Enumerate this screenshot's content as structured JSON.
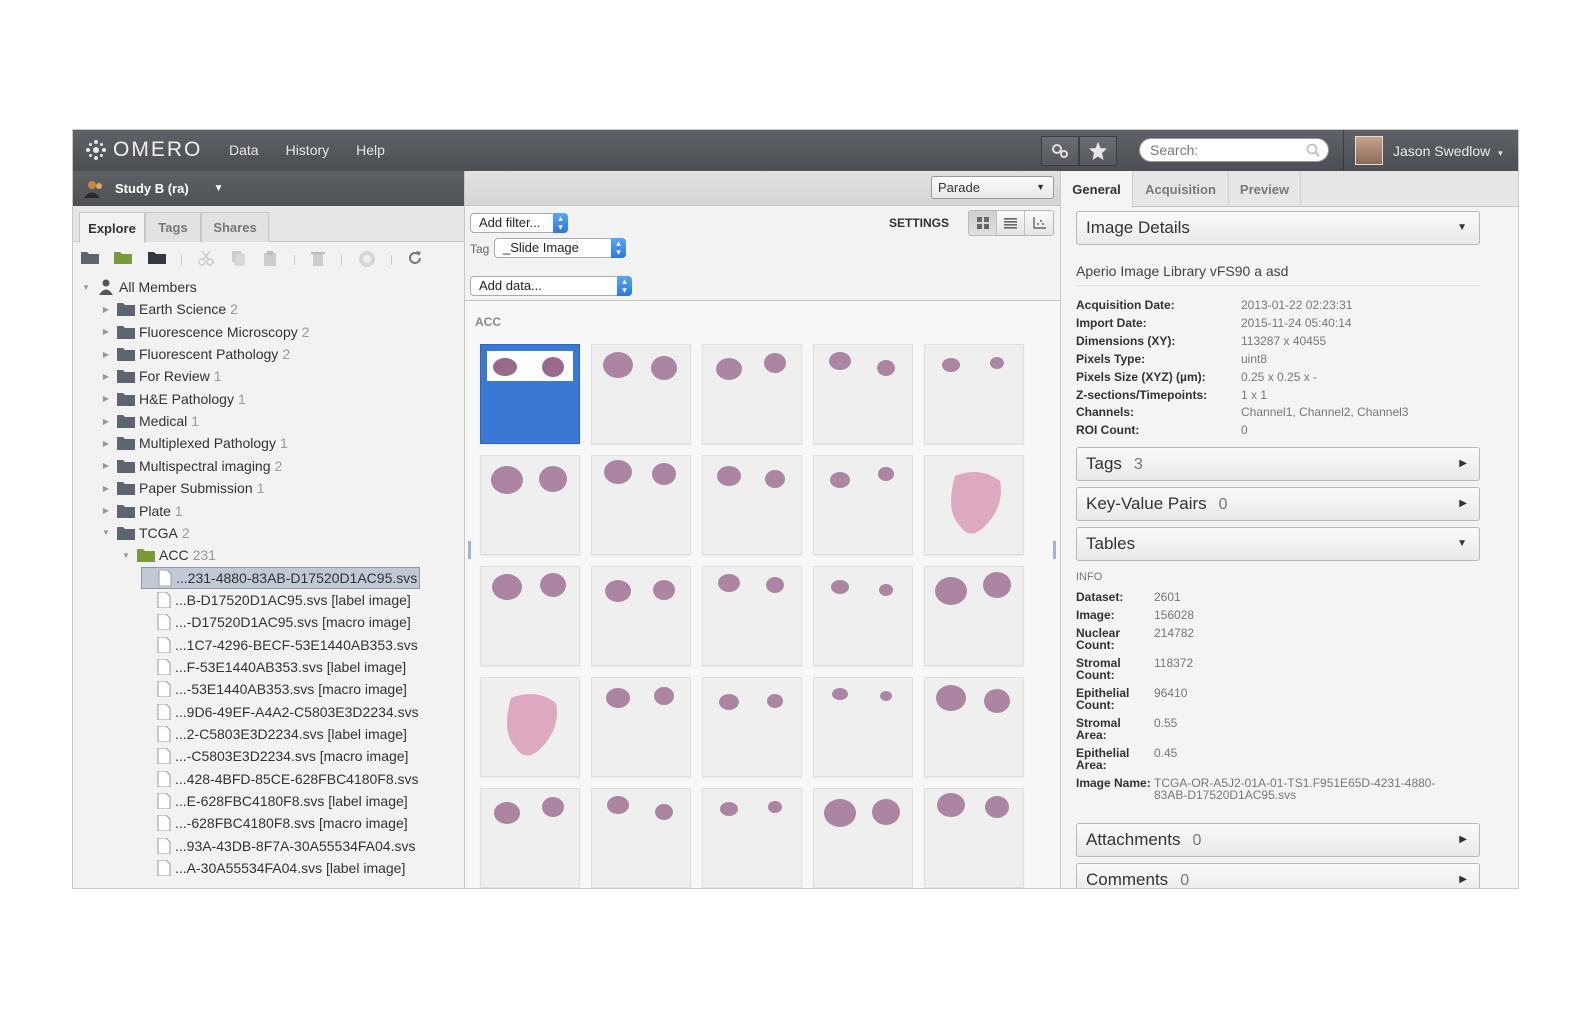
{
  "topbar": {
    "logo": "OMERO",
    "nav": [
      "Data",
      "History",
      "Help"
    ],
    "search_placeholder": "Search:",
    "user": "Jason Swedlow"
  },
  "left": {
    "group": "Study B (ra)",
    "tabs": [
      "Explore",
      "Tags",
      "Shares"
    ],
    "tree_root": "All Members",
    "projects": [
      {
        "name": "Earth Science",
        "count": "2"
      },
      {
        "name": "Fluorescence Microscopy",
        "count": "2"
      },
      {
        "name": "Fluorescent Pathology",
        "count": "2"
      },
      {
        "name": "For Review",
        "count": "1"
      },
      {
        "name": "H&E Pathology",
        "count": "1"
      },
      {
        "name": "Medical",
        "count": "1"
      },
      {
        "name": "Multiplexed Pathology",
        "count": "1"
      },
      {
        "name": "Multispectral imaging",
        "count": "2"
      },
      {
        "name": "Paper Submission",
        "count": "1"
      },
      {
        "name": "Plate",
        "count": "1"
      },
      {
        "name": "TCGA",
        "count": "2"
      }
    ],
    "dataset": {
      "name": "ACC",
      "count": "231"
    },
    "images": [
      "...231-4880-83AB-D17520D1AC95.svs",
      "...B-D17520D1AC95.svs [label image]",
      "...-D17520D1AC95.svs [macro image]",
      "...1C7-4296-BECF-53E1440AB353.svs",
      "...F-53E1440AB353.svs [label image]",
      "...-53E1440AB353.svs [macro image]",
      "...9D6-49EF-A4A2-C5803E3D2234.svs",
      "...2-C5803E3D2234.svs [label image]",
      "...-C5803E3D2234.svs [macro image]",
      "...428-4BFD-85CE-628FBC4180F8.svs",
      "...E-628FBC4180F8.svs [label image]",
      "...-628FBC4180F8.svs [macro image]",
      "...93A-43DB-8F7A-30A55534FA04.svs",
      "...A-30A55534FA04.svs [label image]"
    ]
  },
  "center": {
    "layout": "Parade",
    "add_filter": "Add filter...",
    "settings": "SETTINGS",
    "tag_label": "Tag",
    "tag_value": "_Slide Image",
    "add_data": "Add data...",
    "dataset_title": "ACC",
    "thumbnail_count": 25
  },
  "right": {
    "tabs": [
      "General",
      "Acquisition",
      "Preview"
    ],
    "image_details": "Image Details",
    "image_title": "Aperio Image Library vFS90 a asd",
    "details": [
      {
        "k": "Acquisition Date:",
        "v": "2013-01-22 02:23:31"
      },
      {
        "k": "Import Date:",
        "v": "2015-11-24 05:40:14"
      },
      {
        "k": "Dimensions (XY):",
        "v": "113287 x 40455"
      },
      {
        "k": "Pixels Type:",
        "v": "uint8"
      },
      {
        "k": "Pixels Size (XYZ) (µm):",
        "v": "0.25 x 0.25 x -"
      },
      {
        "k": "Z-sections/Timepoints:",
        "v": "1 x 1"
      },
      {
        "k": "Channels:",
        "v": "Channel1, Channel2, Channel3"
      },
      {
        "k": "ROI Count:",
        "v": "0"
      }
    ],
    "tags": {
      "label": "Tags",
      "count": "3"
    },
    "kvpairs": {
      "label": "Key-Value Pairs",
      "count": "0"
    },
    "tables": "Tables",
    "info_title": "INFO",
    "info": [
      {
        "k": "Dataset:",
        "v": "2601"
      },
      {
        "k": "Image:",
        "v": "156028"
      },
      {
        "k": "Nuclear Count:",
        "v": "214782"
      },
      {
        "k": "Stromal Count:",
        "v": "118372"
      },
      {
        "k": "Epithelial Count:",
        "v": "96410"
      },
      {
        "k": "Stromal Area:",
        "v": "0.55"
      },
      {
        "k": "Epithelial Area:",
        "v": "0.45"
      },
      {
        "k": "Image Name:",
        "v": "TCGA-OR-A5J2-01A-01-TS1.F951E65D-4231-4880-83AB-D17520D1AC95.svs"
      }
    ],
    "attachments": {
      "label": "Attachments",
      "count": "0"
    },
    "comments": {
      "label": "Comments",
      "count": "0"
    }
  },
  "colors": {
    "accent": "#3a78d6",
    "topbar": "#55585c",
    "tissue": "#9a6a8e"
  }
}
